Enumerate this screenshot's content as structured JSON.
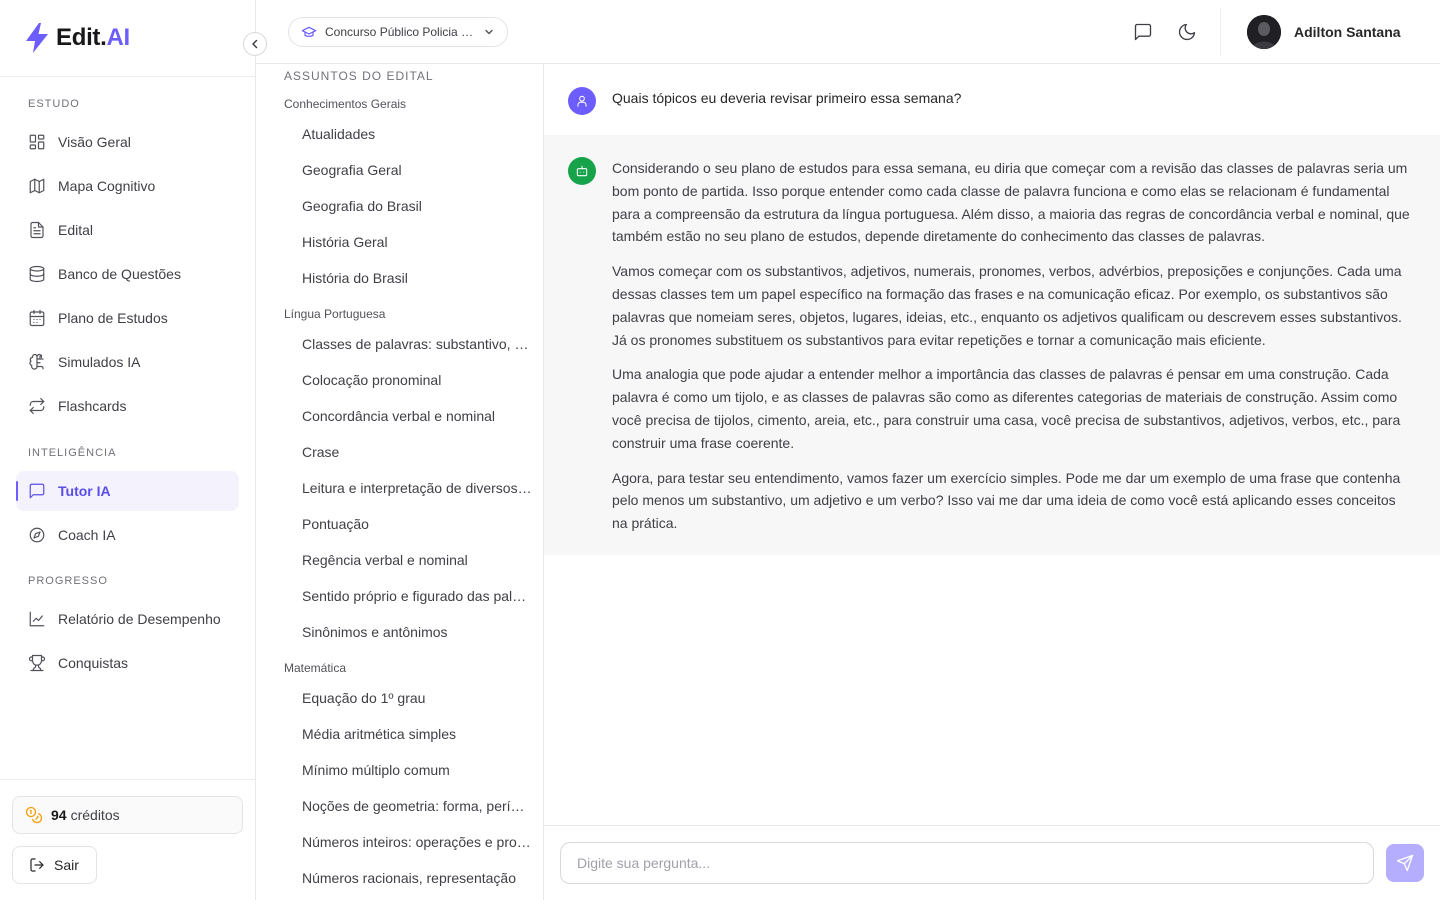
{
  "app": {
    "logo_text": "Edit.",
    "logo_accent": "AI",
    "accent_color": "#6d5dfc"
  },
  "sidebar": {
    "sections": [
      {
        "label": "ESTUDO",
        "items": [
          {
            "label": "Visão Geral",
            "icon": "layout-grid-icon"
          },
          {
            "label": "Mapa Cognitivo",
            "icon": "map-icon"
          },
          {
            "label": "Edital",
            "icon": "file-text-icon"
          },
          {
            "label": "Banco de Questões",
            "icon": "database-icon"
          },
          {
            "label": "Plano de Estudos",
            "icon": "calendar-icon"
          },
          {
            "label": "Simulados IA",
            "icon": "brain-icon"
          },
          {
            "label": "Flashcards",
            "icon": "repeat-icon"
          }
        ]
      },
      {
        "label": "INTELIGÊNCIA",
        "items": [
          {
            "label": "Tutor IA",
            "icon": "message-square-icon",
            "active": true
          },
          {
            "label": "Coach IA",
            "icon": "compass-icon"
          }
        ]
      },
      {
        "label": "PROGRESSO",
        "items": [
          {
            "label": "Relatório de Desempenho",
            "icon": "line-chart-icon"
          },
          {
            "label": "Conquistas",
            "icon": "trophy-icon"
          }
        ]
      }
    ],
    "credits_count": "94",
    "credits_label": "créditos",
    "logout_label": "Sair"
  },
  "header": {
    "contest_name": "Concurso Público Policia Civil",
    "username": "Adilton Santana"
  },
  "topics": {
    "title": "ASSUNTOS DO EDITAL",
    "groups": [
      {
        "name": "Conhecimentos Gerais",
        "items": [
          "Atualidades",
          "Geografia Geral",
          "Geografia do Brasil",
          "História Geral",
          "História do Brasil"
        ]
      },
      {
        "name": "Língua Portuguesa",
        "items": [
          "Classes de palavras: substantivo, adjetivo, verbo",
          "Colocação pronominal",
          "Concordância verbal e nominal",
          "Crase",
          "Leitura e interpretação de diversos textos",
          "Pontuação",
          "Regência verbal e nominal",
          "Sentido próprio e figurado das palavras",
          "Sinônimos e antônimos"
        ]
      },
      {
        "name": "Matemática",
        "items": [
          "Equação do 1º grau",
          "Média aritmética simples",
          "Mínimo múltiplo comum",
          "Noções de geometria: forma, perímetro, área",
          "Números inteiros: operações e propriedades",
          "Números racionais, representação"
        ]
      }
    ]
  },
  "chat": {
    "user_message": "Quais tópicos eu deveria revisar primeiro essa semana?",
    "bot_paragraphs": [
      "Considerando o seu plano de estudos para essa semana, eu diria que começar com a revisão das classes de palavras seria um bom ponto de partida. Isso porque entender como cada classe de palavra funciona e como elas se relacionam é fundamental para a compreensão da estrutura da língua portuguesa. Além disso, a maioria das regras de concordância verbal e nominal, que também estão no seu plano de estudos, depende diretamente do conhecimento das classes de palavras.",
      "Vamos começar com os substantivos, adjetivos, numerais, pronomes, verbos, advérbios, preposições e conjunções. Cada uma dessas classes tem um papel específico na formação das frases e na comunicação eficaz. Por exemplo, os substantivos são palavras que nomeiam seres, objetos, lugares, ideias, etc., enquanto os adjetivos qualificam ou descrevem esses substantivos. Já os pronomes substituem os substantivos para evitar repetições e tornar a comunicação mais eficiente.",
      "Uma analogia que pode ajudar a entender melhor a importância das classes de palavras é pensar em uma construção. Cada palavra é como um tijolo, e as classes de palavras são como as diferentes categorias de materiais de construção. Assim como você precisa de tijolos, cimento, areia, etc., para construir uma casa, você precisa de substantivos, adjetivos, verbos, etc., para construir uma frase coerente.",
      "Agora, para testar seu entendimento, vamos fazer um exercício simples. Pode me dar um exemplo de uma frase que contenha pelo menos um substantivo, um adjetivo e um verbo? Isso vai me dar uma ideia de como você está aplicando esses conceitos na prática."
    ],
    "input_placeholder": "Digite sua pergunta..."
  }
}
